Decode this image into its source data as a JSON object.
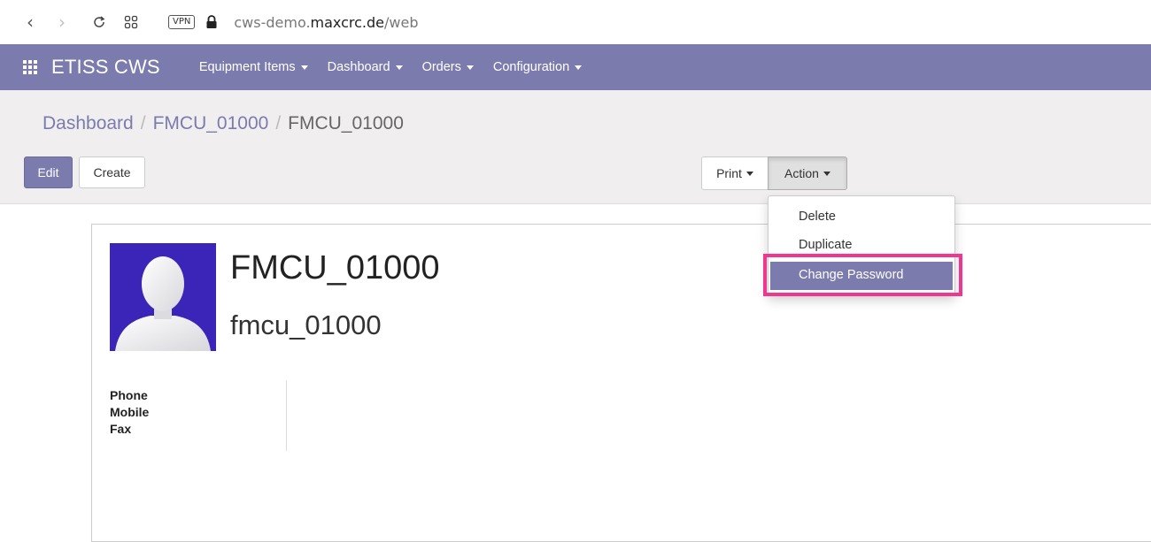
{
  "browser": {
    "url_prefix": "cws-demo.",
    "url_host": "maxcrc.de",
    "url_path": "/web",
    "vpn_label": "VPN"
  },
  "navbar": {
    "brand": "ETISS CWS",
    "menu": [
      {
        "label": "Equipment Items"
      },
      {
        "label": "Dashboard"
      },
      {
        "label": "Orders"
      },
      {
        "label": "Configuration"
      }
    ],
    "color": "#7c7bad"
  },
  "breadcrumb": {
    "items": [
      "Dashboard",
      "FMCU_01000",
      "FMCU_01000"
    ],
    "separator": "/"
  },
  "toolbar": {
    "edit_label": "Edit",
    "create_label": "Create",
    "print_label": "Print",
    "action_label": "Action"
  },
  "action_menu": {
    "items": [
      {
        "label": "Delete"
      },
      {
        "label": "Duplicate"
      },
      {
        "label": "Change Password",
        "active": true
      }
    ],
    "highlight_color": "#f0368f"
  },
  "record": {
    "name": "FMCU_01000",
    "login": "fmcu_01000",
    "fields": [
      {
        "label": "Phone"
      },
      {
        "label": "Mobile"
      },
      {
        "label": "Fax"
      }
    ],
    "avatar_color": "#3b24b8"
  }
}
